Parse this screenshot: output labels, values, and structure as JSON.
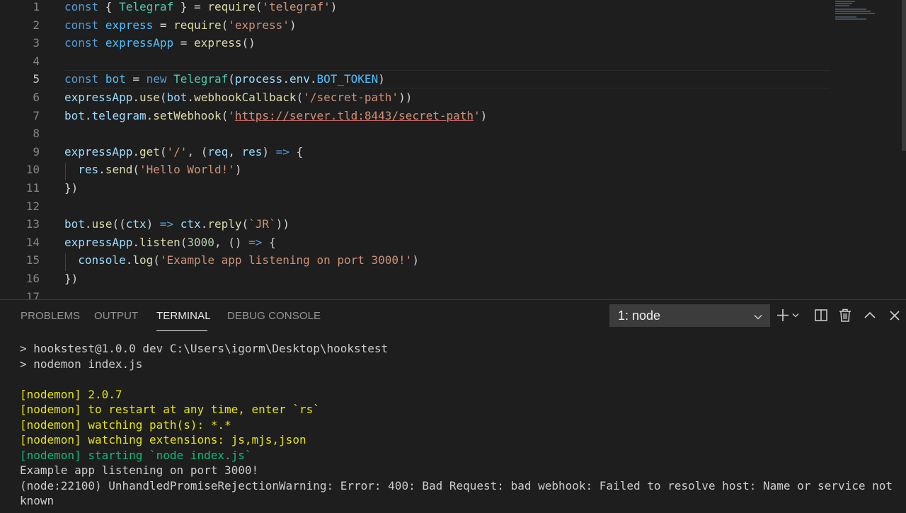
{
  "editor": {
    "lines": [
      {
        "n": "1",
        "tokens": [
          [
            "kw",
            "const"
          ],
          [
            "pun",
            " { "
          ],
          [
            "cls",
            "Telegraf"
          ],
          [
            "pun",
            " } = "
          ],
          [
            "fn",
            "require"
          ],
          [
            "pun",
            "("
          ],
          [
            "str",
            "'telegraf'"
          ],
          [
            "pun",
            ")"
          ]
        ]
      },
      {
        "n": "2",
        "tokens": [
          [
            "kw",
            "const"
          ],
          [
            "pun",
            " "
          ],
          [
            "var",
            "express"
          ],
          [
            "pun",
            " = "
          ],
          [
            "fn",
            "require"
          ],
          [
            "pun",
            "("
          ],
          [
            "str",
            "'express'"
          ],
          [
            "pun",
            ")"
          ]
        ]
      },
      {
        "n": "3",
        "tokens": [
          [
            "kw",
            "const"
          ],
          [
            "pun",
            " "
          ],
          [
            "var",
            "expressApp"
          ],
          [
            "pun",
            " = "
          ],
          [
            "fn",
            "express"
          ],
          [
            "pun",
            "()"
          ]
        ]
      },
      {
        "n": "4",
        "tokens": []
      },
      {
        "n": "5",
        "tokens": [
          [
            "kw",
            "const"
          ],
          [
            "pun",
            " "
          ],
          [
            "var",
            "bot"
          ],
          [
            "pun",
            " = "
          ],
          [
            "kw",
            "new"
          ],
          [
            "pun",
            " "
          ],
          [
            "cls",
            "Telegraf"
          ],
          [
            "pun",
            "("
          ],
          [
            "id",
            "process"
          ],
          [
            "pun",
            "."
          ],
          [
            "id",
            "env"
          ],
          [
            "pun",
            "."
          ],
          [
            "var",
            "BOT_TOKEN"
          ],
          [
            "pun",
            ")"
          ]
        ]
      },
      {
        "n": "6",
        "tokens": [
          [
            "id",
            "expressApp"
          ],
          [
            "pun",
            "."
          ],
          [
            "fn",
            "use"
          ],
          [
            "pun",
            "("
          ],
          [
            "id",
            "bot"
          ],
          [
            "pun",
            "."
          ],
          [
            "fn",
            "webhookCallback"
          ],
          [
            "pun",
            "("
          ],
          [
            "str",
            "'/secret-path'"
          ],
          [
            "pun",
            "))"
          ]
        ]
      },
      {
        "n": "7",
        "tokens": [
          [
            "id",
            "bot"
          ],
          [
            "pun",
            "."
          ],
          [
            "id",
            "telegram"
          ],
          [
            "pun",
            "."
          ],
          [
            "fn",
            "setWebhook"
          ],
          [
            "pun",
            "("
          ],
          [
            "str",
            "'"
          ],
          [
            "str underline",
            "https://server.tld:8443/secret-path"
          ],
          [
            "str",
            "'"
          ],
          [
            "pun",
            ")"
          ]
        ]
      },
      {
        "n": "8",
        "tokens": []
      },
      {
        "n": "9",
        "tokens": [
          [
            "id",
            "expressApp"
          ],
          [
            "pun",
            "."
          ],
          [
            "fn",
            "get"
          ],
          [
            "pun",
            "("
          ],
          [
            "str",
            "'/'"
          ],
          [
            "pun",
            ", ("
          ],
          [
            "id",
            "req"
          ],
          [
            "pun",
            ", "
          ],
          [
            "id",
            "res"
          ],
          [
            "pun",
            ") "
          ],
          [
            "kw",
            "=>"
          ],
          [
            "pun",
            " {"
          ]
        ]
      },
      {
        "n": "10",
        "tokens": [
          [
            "pun",
            "  "
          ],
          [
            "id",
            "res"
          ],
          [
            "pun",
            "."
          ],
          [
            "fn",
            "send"
          ],
          [
            "pun",
            "("
          ],
          [
            "str",
            "'Hello World!'"
          ],
          [
            "pun",
            ")"
          ]
        ]
      },
      {
        "n": "11",
        "tokens": [
          [
            "pun",
            "})"
          ]
        ]
      },
      {
        "n": "12",
        "tokens": []
      },
      {
        "n": "13",
        "tokens": [
          [
            "id",
            "bot"
          ],
          [
            "pun",
            "."
          ],
          [
            "fn",
            "use"
          ],
          [
            "pun",
            "(("
          ],
          [
            "id",
            "ctx"
          ],
          [
            "pun",
            ") "
          ],
          [
            "kw",
            "=>"
          ],
          [
            "pun",
            " "
          ],
          [
            "id",
            "ctx"
          ],
          [
            "pun",
            "."
          ],
          [
            "fn",
            "reply"
          ],
          [
            "pun",
            "("
          ],
          [
            "str",
            "`JR`"
          ],
          [
            "pun",
            "))"
          ]
        ]
      },
      {
        "n": "14",
        "tokens": [
          [
            "id",
            "expressApp"
          ],
          [
            "pun",
            "."
          ],
          [
            "fn",
            "listen"
          ],
          [
            "pun",
            "("
          ],
          [
            "num",
            "3000"
          ],
          [
            "pun",
            ", () "
          ],
          [
            "kw",
            "=>"
          ],
          [
            "pun",
            " {"
          ]
        ]
      },
      {
        "n": "15",
        "tokens": [
          [
            "pun",
            "  "
          ],
          [
            "id",
            "console"
          ],
          [
            "pun",
            "."
          ],
          [
            "fn",
            "log"
          ],
          [
            "pun",
            "("
          ],
          [
            "str",
            "'Example app listening on port 3000!'"
          ],
          [
            "pun",
            ")"
          ]
        ]
      },
      {
        "n": "16",
        "tokens": [
          [
            "pun",
            "})"
          ]
        ]
      },
      {
        "n": "17",
        "tokens": []
      }
    ],
    "active_line": "5"
  },
  "panel": {
    "tabs": [
      "PROBLEMS",
      "OUTPUT",
      "TERMINAL",
      "DEBUG CONSOLE"
    ],
    "active_tab": "TERMINAL",
    "terminal_select": "1: node",
    "terminal_lines": [
      {
        "cls": "",
        "text": "> hookstest@1.0.0 dev C:\\Users\\igorm\\Desktop\\hookstest"
      },
      {
        "cls": "",
        "text": "> nodemon index.js"
      },
      {
        "cls": "",
        "text": ""
      },
      {
        "cls": "yellow",
        "text": "[nodemon] 2.0.7"
      },
      {
        "cls": "yellow",
        "text": "[nodemon] to restart at any time, enter `rs`"
      },
      {
        "cls": "yellow",
        "text": "[nodemon] watching path(s): *.*"
      },
      {
        "cls": "yellow",
        "text": "[nodemon] watching extensions: js,mjs,json"
      },
      {
        "cls": "green",
        "text": "[nodemon] starting `node index.js`"
      },
      {
        "cls": "",
        "text": "Example app listening on port 3000!"
      },
      {
        "cls": "",
        "text": "(node:22100) UnhandledPromiseRejectionWarning: Error: 400: Bad Request: bad webhook: Failed to resolve host: Name or service not known"
      }
    ],
    "icons": [
      "plus-icon",
      "split-terminal-icon",
      "trash-icon",
      "chevron-up-icon",
      "close-icon"
    ]
  }
}
